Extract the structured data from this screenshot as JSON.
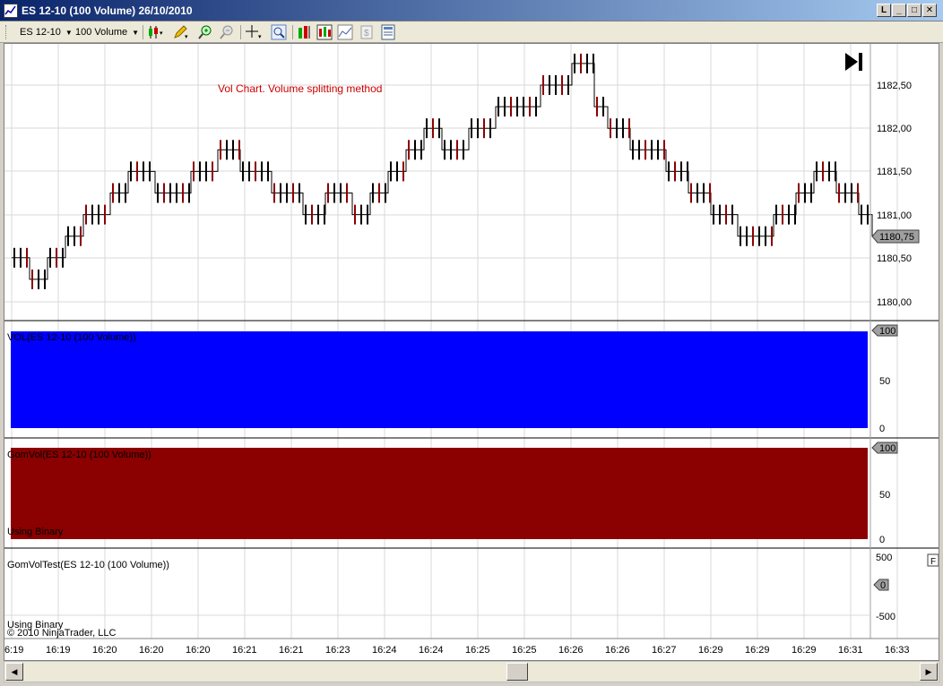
{
  "window": {
    "title": "ES 12-10 (100 Volume)  26/10/2010",
    "buttons": [
      "L",
      "_",
      "□",
      "✕"
    ]
  },
  "toolbar": {
    "instrument": "ES 12-10",
    "period": "100 Volume",
    "icons": [
      "candlestick-style-icon",
      "pencil-draw-icon",
      "zoom-in-icon",
      "zoom-out-icon",
      "crosshair-icon",
      "magnifier-icon",
      "indicators-icon",
      "strategies-icon",
      "data-box-icon",
      "chart-trader-icon",
      "properties-icon"
    ]
  },
  "colors": {
    "up_bar": "#8b0000",
    "down_bar": "#2e7d32",
    "vol_fill": "#0000ff",
    "gomvol_fill": "#8b0000",
    "annotation": "#cc0000",
    "grid": "#d8d8d8"
  },
  "annotation": "Vol Chart. Volume splitting method",
  "price_marker": "1180,75",
  "price_axis": [
    "1182,50",
    "1182,00",
    "1181,50",
    "1181,00",
    "1180,50",
    "1180,00"
  ],
  "vol_panel": {
    "title": "VOL(ES 12-10 (100 Volume))",
    "axis": [
      "50",
      "0"
    ],
    "marker": "100"
  },
  "gomvol_panel": {
    "title": "GomVol(ES 12-10 (100 Volume))",
    "subtitle": "Using Binary",
    "axis": [
      "50",
      "0"
    ],
    "marker": "100"
  },
  "gomvoltest_panel": {
    "title": "GomVolTest(ES 12-10 (100 Volume))",
    "subtitle": "Using Binary",
    "copyright": "© 2010 NinjaTrader, LLC",
    "axis": [
      "500",
      "-500"
    ],
    "marker": "0",
    "flag": "F"
  },
  "time_axis": [
    "6:19",
    "16:19",
    "16:20",
    "16:20",
    "16:20",
    "16:21",
    "16:21",
    "16:23",
    "16:24",
    "16:24",
    "16:25",
    "16:25",
    "16:26",
    "16:26",
    "16:27",
    "16:29",
    "16:29",
    "16:29",
    "16:31",
    "16:33"
  ],
  "chart_data": {
    "type": "bar",
    "description_panels": [
      "price",
      "VOL",
      "GomVol",
      "GomVolTest"
    ],
    "price_ticks": [
      1180.0,
      1180.5,
      1181.0,
      1181.5,
      1182.0,
      1182.5
    ],
    "last_price": 1180.75,
    "vol_range": [
      0,
      100
    ],
    "gomvoltest_range": [
      -500,
      500
    ]
  }
}
